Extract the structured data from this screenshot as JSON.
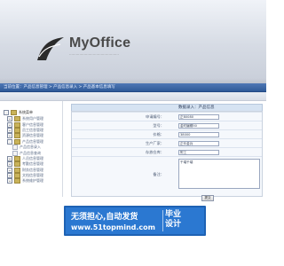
{
  "header": {
    "logo_title": "MyOffice",
    "logo_subtitle": "............................................"
  },
  "navbar": {
    "breadcrumb": "当前位置：产品信息管理 > 产品信息录入 > 产品基本信息填写"
  },
  "sidebar": {
    "root_label": "系统菜单",
    "items": [
      {
        "label": "系统用户管理",
        "type": "folder",
        "expanded": false
      },
      {
        "label": "客户信息管理",
        "type": "folder",
        "expanded": false
      },
      {
        "label": "员工信息管理",
        "type": "folder",
        "expanded": false
      },
      {
        "label": "资源信息管理",
        "type": "folder",
        "expanded": false
      },
      {
        "label": "产品信息管理",
        "type": "folder",
        "expanded": true
      },
      {
        "label": "产品信息录入",
        "type": "leaf",
        "sub": true
      },
      {
        "label": "产品信息查询",
        "type": "leaf",
        "sub": true
      },
      {
        "label": "人员信息管理",
        "type": "folder",
        "expanded": false
      },
      {
        "label": "考勤信息管理",
        "type": "folder",
        "expanded": false
      },
      {
        "label": "财务信息管理",
        "type": "folder",
        "expanded": false
      },
      {
        "label": "文档信息管理",
        "type": "folder",
        "expanded": false
      },
      {
        "label": "系统维护管理",
        "type": "folder",
        "expanded": false
      }
    ]
  },
  "main": {
    "title": "数据录入：产品信息",
    "rows": [
      {
        "label": "申请编号：",
        "value": "正80080"
      },
      {
        "label": "型号：",
        "value": "金时编辑50"
      },
      {
        "label": "价格：",
        "value": "38000"
      },
      {
        "label": "生产厂家：",
        "value": "正价金兵"
      },
      {
        "label": "存放仓库：",
        "value": "附工"
      }
    ],
    "note_label": "备注：",
    "note_value": "千端千端",
    "submit_label": "提交"
  },
  "watermark": {
    "line1": "无须担心,自动发货",
    "url": "www.51topmind.com",
    "right_line1": "毕业",
    "right_line2": "设计"
  }
}
